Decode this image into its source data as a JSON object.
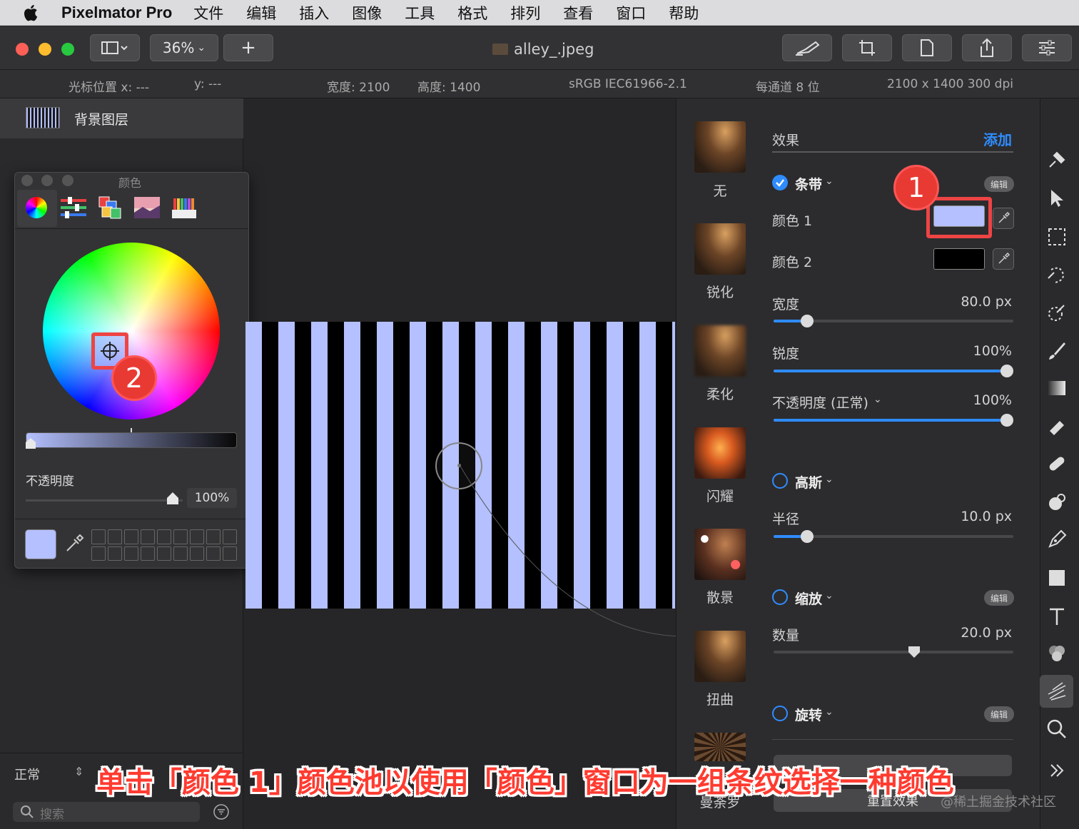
{
  "menubar": {
    "app": "Pixelmator Pro",
    "items": [
      "文件",
      "编辑",
      "插入",
      "图像",
      "工具",
      "格式",
      "排列",
      "查看",
      "窗口",
      "帮助"
    ]
  },
  "toolbar": {
    "zoom": "36%",
    "add": "+",
    "doc_title": "alley_.jpeg"
  },
  "infobar": {
    "cursor_x": "光标位置 x: ---",
    "cursor_y": "y: ---",
    "width": "宽度: 2100",
    "height": "高度: 1400",
    "profile": "sRGB IEC61966-2.1",
    "depth": "每通道 8 位",
    "dims": "2100 x 1400 300 dpi"
  },
  "layers": {
    "name": "背景图层",
    "blend": "正常",
    "search_placeholder": "搜索"
  },
  "color_window": {
    "title": "颜色",
    "opacity_label": "不透明度",
    "opacity_value": "100%",
    "current_color": "#b4c0ff"
  },
  "effects_browser": {
    "items": [
      "无",
      "锐化",
      "柔化",
      "闪耀",
      "散景",
      "扭曲",
      "曼荼罗"
    ]
  },
  "effects": {
    "header": "效果",
    "add": "添加",
    "stripes": {
      "title": "条带",
      "edit": "编辑",
      "color1_label": "颜色 1",
      "color1": "#b4c0ff",
      "color2_label": "颜色 2",
      "color2": "#000000",
      "width_label": "宽度",
      "width_value": "80.0 px",
      "width_level": 0.12,
      "sharp_label": "锐度",
      "sharp_value": "100%",
      "sharp_level": 1.0,
      "opacity_label": "不透明度 (正常)",
      "opacity_value": "100%",
      "opacity_level": 1.0
    },
    "gaussian": {
      "title": "高斯",
      "radius_label": "半径",
      "radius_value": "10.0 px",
      "radius_level": 0.12
    },
    "zoom": {
      "title": "缩放",
      "edit": "编辑",
      "amount_label": "数量",
      "amount_value": "20.0 px",
      "amount_level": 0.59
    },
    "rotate": {
      "title": "旋转",
      "edit": "编辑"
    },
    "reset": "重置效果"
  },
  "annotations": {
    "badge1": "1",
    "badge2": "2",
    "caption": "单击「颜色 1」颜色池以使用「颜色」窗口为一组条纹选择一种颜色",
    "watermark": "@稀土掘金技术社区"
  }
}
